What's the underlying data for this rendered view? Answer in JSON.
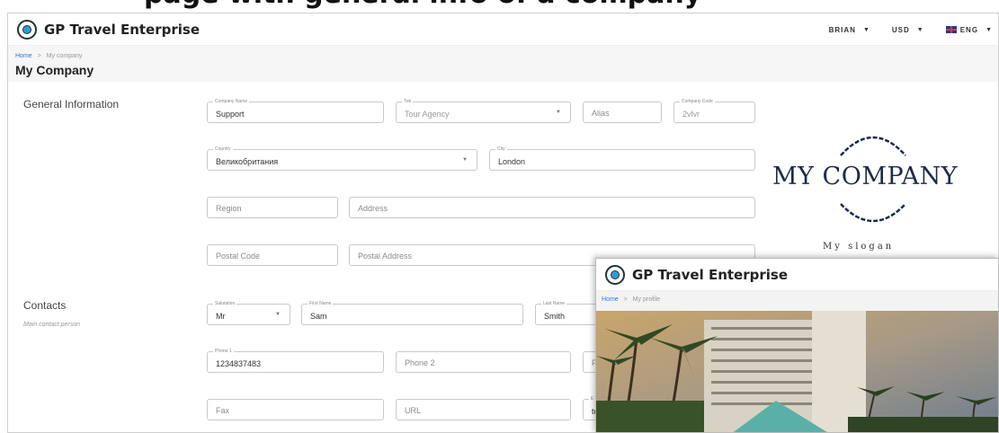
{
  "banner": {
    "text": "page with general info of a company"
  },
  "app": {
    "brand": "GP Travel Enterprise"
  },
  "header": {
    "user": "BRIAN",
    "currency": "USD",
    "language": "ENG"
  },
  "breadcrumb": {
    "home": "Home",
    "separator": ">",
    "current": "My company"
  },
  "page": {
    "title": "My Company"
  },
  "general": {
    "title": "General Information",
    "company_name": {
      "label": "Company Name",
      "value": "Support"
    },
    "type": {
      "label": "Тип",
      "value": "Tour Agency"
    },
    "alias": {
      "placeholder": "Alias"
    },
    "company_code": {
      "label": "Company Code",
      "value": "2vlvr"
    },
    "country": {
      "label": "Country",
      "value": "Великобритания"
    },
    "city": {
      "label": "City",
      "value": "London"
    },
    "region": {
      "placeholder": "Region"
    },
    "address": {
      "placeholder": "Address"
    },
    "postal_code": {
      "placeholder": "Postal Code"
    },
    "postal_address": {
      "placeholder": "Postal Address"
    }
  },
  "logo": {
    "company": "MY COMPANY",
    "slogan": "My slogan"
  },
  "contacts": {
    "title": "Contacts",
    "subtitle": "Main contact person",
    "salutation": {
      "label": "Salutation",
      "value": "Mr"
    },
    "first_name": {
      "label": "First Name",
      "value": "Sam"
    },
    "last_name": {
      "label": "Last Name",
      "value": "Smith"
    },
    "phone1": {
      "label": "Phone 1",
      "value": "1234837483"
    },
    "phone2": {
      "placeholder": "Phone 2"
    },
    "phone3": {
      "partial": "Ph"
    },
    "fax": {
      "placeholder": "Fax"
    },
    "url": {
      "placeholder": "URL"
    },
    "email": {
      "label": "E",
      "partial": "te"
    }
  },
  "overlay": {
    "brand": "GP Travel Enterprise",
    "breadcrumb": {
      "home": "Home",
      "separator": ">",
      "current": "My profile"
    }
  }
}
